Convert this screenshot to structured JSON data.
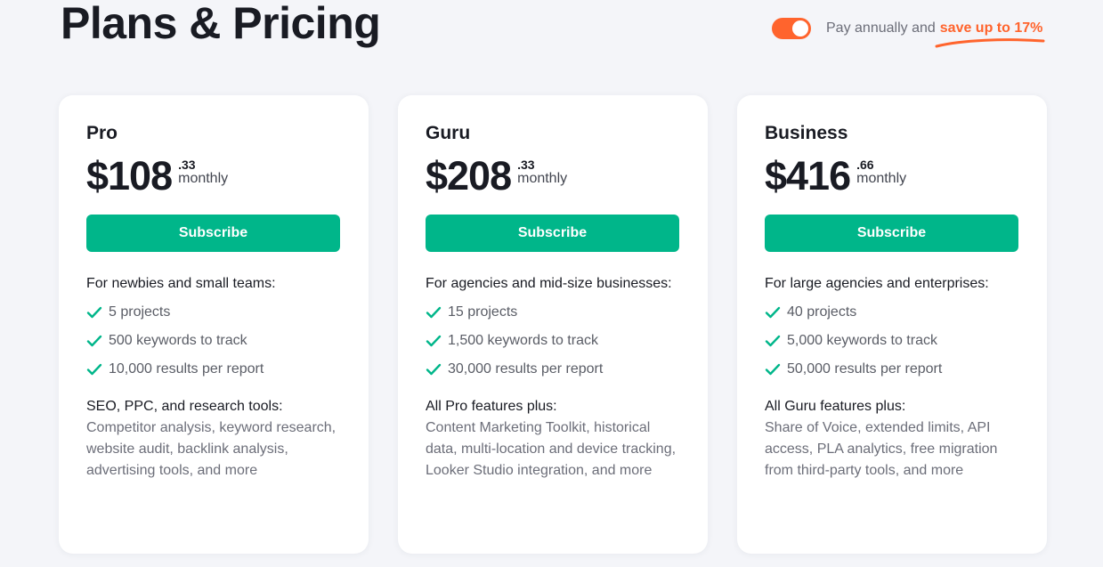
{
  "page": {
    "title": "Plans & Pricing"
  },
  "billing": {
    "toggle_on": true,
    "label": "Pay annually and",
    "highlight": "save up to 17%",
    "accent_color": "#ff642d"
  },
  "colors": {
    "subscribe_button": "#00b68a",
    "check_icon": "#00b68a"
  },
  "plans": [
    {
      "name": "Pro",
      "price_whole": "$108",
      "price_cents": ".33",
      "period": "monthly",
      "button_label": "Subscribe",
      "audience": "For newbies and small teams:",
      "features": [
        "5 projects",
        "500 keywords to track",
        "10,000 results per report"
      ],
      "extra_title": "SEO, PPC, and research tools:",
      "extra_body": "Competitor analysis, keyword research, website audit, backlink analysis, advertising tools, and more"
    },
    {
      "name": "Guru",
      "price_whole": "$208",
      "price_cents": ".33",
      "period": "monthly",
      "button_label": "Subscribe",
      "audience": "For agencies and mid-size businesses:",
      "features": [
        "15 projects",
        "1,500 keywords to track",
        "30,000 results per report"
      ],
      "extra_title": "All Pro features plus:",
      "extra_body": "Content Marketing Toolkit, historical data, multi-location and device tracking, Looker Studio integration, and more"
    },
    {
      "name": "Business",
      "price_whole": "$416",
      "price_cents": ".66",
      "period": "monthly",
      "button_label": "Subscribe",
      "audience": "For large agencies and enterprises:",
      "features": [
        "40 projects",
        "5,000 keywords to track",
        "50,000 results per report"
      ],
      "extra_title": "All Guru features plus:",
      "extra_body": "Share of Voice, extended limits, API access, PLA analytics, free migration from third-party tools, and more"
    }
  ]
}
